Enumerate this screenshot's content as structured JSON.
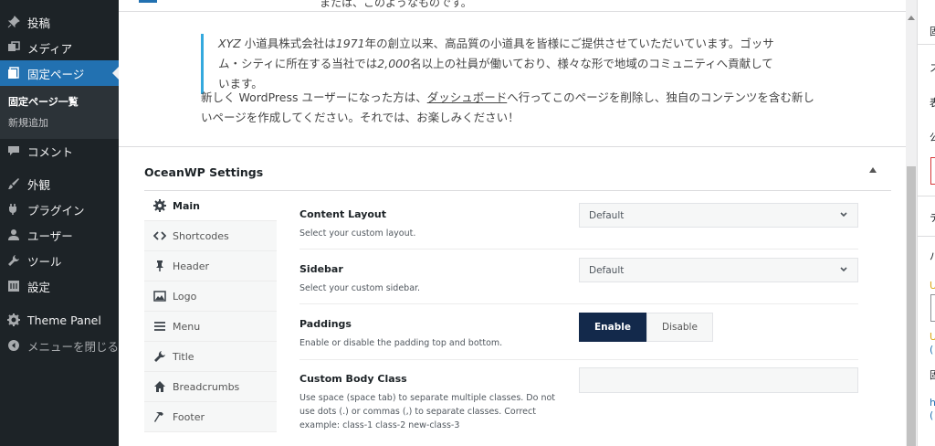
{
  "sidebar": {
    "items": [
      {
        "label": "投稿",
        "icon": "pushpin-icon"
      },
      {
        "label": "メディア",
        "icon": "media-icon"
      },
      {
        "label": "固定ページ",
        "icon": "pages-icon"
      },
      {
        "label": "コメント",
        "icon": "comment-icon"
      },
      {
        "label": "外観",
        "icon": "appearance-brush-icon"
      },
      {
        "label": "プラグイン",
        "icon": "plugin-icon"
      },
      {
        "label": "ユーザー",
        "icon": "user-icon"
      },
      {
        "label": "ツール",
        "icon": "wrench-icon"
      },
      {
        "label": "設定",
        "icon": "settings-icon"
      },
      {
        "label": "Theme Panel",
        "icon": "gear-icon"
      }
    ],
    "submenu": [
      {
        "label": "固定ページ一覧"
      },
      {
        "label": "新規追加"
      }
    ],
    "collapse_label": "メニューを閉じる"
  },
  "content": {
    "cut_line": "または、このようなものです。",
    "quote_lines": [
      "小道具株式会社は",
      "年の創立以来、高品質の小道具を皆様にご提供させていただいています。ゴッサム・シティに所在する",
      "当社では",
      "名以上の社員が働いており、様々な形で地域のコミュニティへ貢献しています。"
    ],
    "quote_xyz": "XYZ",
    "quote_year": "1971",
    "quote_count": "2,000",
    "para_before": "新しく WordPress ユーザーになった方は、",
    "para_link": "ダッシュボード",
    "para_after": "へ行ってこのページを削除し、独自のコンテンツを含む新しいページを作成してください。それでは、お楽しみください！"
  },
  "metabox": {
    "title": "OceanWP Settings",
    "tabs": [
      {
        "label": "Main",
        "icon": "gear-icon"
      },
      {
        "label": "Shortcodes",
        "icon": "code-icon"
      },
      {
        "label": "Header",
        "icon": "pushpin-icon"
      },
      {
        "label": "Logo",
        "icon": "image-icon"
      },
      {
        "label": "Menu",
        "icon": "menu-icon"
      },
      {
        "label": "Title",
        "icon": "wrench-icon"
      },
      {
        "label": "Breadcrumbs",
        "icon": "home-icon"
      },
      {
        "label": "Footer",
        "icon": "hammer-icon"
      }
    ],
    "fields": {
      "content_layout": {
        "label": "Content Layout",
        "desc": "Select your custom layout.",
        "value": "Default"
      },
      "sidebar": {
        "label": "Sidebar",
        "desc": "Select your custom sidebar.",
        "value": "Default"
      },
      "paddings": {
        "label": "Paddings",
        "desc": "Enable or disable the padding top and bottom.",
        "enable": "Enable",
        "disable": "Disable",
        "selected": "Enable"
      },
      "body_class": {
        "label": "Custom Body Class",
        "desc": "Use space (space tab) to separate multiple classes. Do not use dots (.) or commas (,) to separate classes. Correct example: class-1 class-2 new-class-3",
        "value": ""
      }
    }
  },
  "right_panel": {
    "fragments": [
      "固",
      "ス",
      "表",
      "公",
      "テ",
      "パ",
      "U",
      "U",
      "(",
      "固",
      "h",
      "("
    ]
  }
}
